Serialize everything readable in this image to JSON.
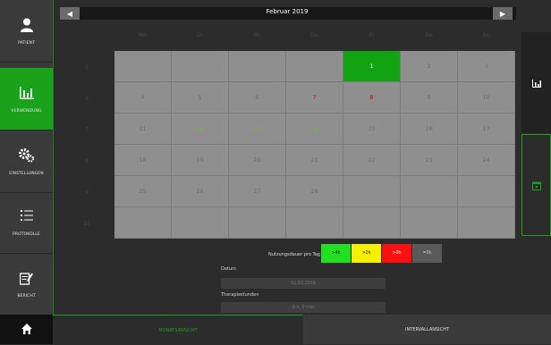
{
  "sidebar": {
    "items": [
      {
        "label": "PATIENT",
        "icon": "user-icon"
      },
      {
        "label": "VERWENDUNG",
        "icon": "bar-chart-icon"
      },
      {
        "label": "EINSTELLUNGEN",
        "icon": "gears-icon"
      },
      {
        "label": "PROTOKOLLE",
        "icon": "list-icon"
      },
      {
        "label": "BERICHT",
        "icon": "edit-icon"
      }
    ],
    "home_icon": "home-icon"
  },
  "calendar": {
    "month": "Februar",
    "year": "2019",
    "weekdays": [
      "Mo.",
      "Di.",
      "Mi.",
      "Do.",
      "Fr.",
      "Sa.",
      "So."
    ],
    "week_numbers": [
      "5",
      "6",
      "7",
      "8",
      "9",
      "10"
    ],
    "rows": [
      [
        "",
        "",
        "",
        "",
        "1",
        "2",
        "3"
      ],
      [
        "4",
        "5",
        "6",
        "7",
        "8",
        "9",
        "10"
      ],
      [
        "11",
        "12",
        "13",
        "14",
        "15",
        "16",
        "17"
      ],
      [
        "18",
        "19",
        "20",
        "21",
        "22",
        "23",
        "24"
      ],
      [
        "25",
        "26",
        "27",
        "28",
        "",
        "",
        ""
      ],
      [
        "",
        "",
        "",
        "",
        "",
        "",
        ""
      ]
    ],
    "selected_day": "1",
    "red_days": [
      "7",
      "8"
    ],
    "green_days": [
      "12",
      "13",
      "14"
    ]
  },
  "legend": {
    "title": "Nutzungsdauer pro Tag",
    "items": [
      {
        "label": ">4h",
        "color": "#22e022",
        "text": "#1a1a1a"
      },
      {
        "label": ">2h",
        "color": "#f5f000",
        "text": "#1a1a1a"
      },
      {
        "label": ">0h",
        "color": "#ff1010",
        "text": "#ffffff"
      },
      {
        "label": "=0h",
        "color": "#5a5a5a",
        "text": "#cfcfcf"
      }
    ]
  },
  "details": {
    "datum_label": "Datum",
    "datum_value": "01.02.2019",
    "therapie_label": "Therapiestunden",
    "therapie_value": "0 h, 0 min"
  },
  "bottom": {
    "left": "MONATSANSICHT",
    "right": "INTERVALLANSICHT"
  },
  "right_panel": {
    "chart_icon": "bar-chart-icon",
    "calendar_icon": "calendar-icon"
  },
  "colors": {
    "accent": "#1aa31a",
    "selected": "#12a312",
    "red": "#e00000",
    "green_text": "#6cbf2a"
  }
}
